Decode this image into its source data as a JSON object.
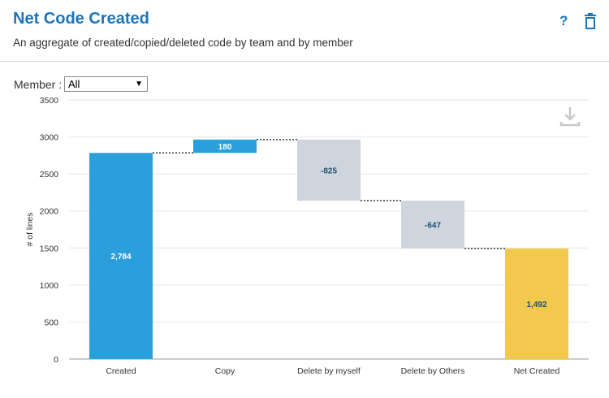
{
  "header": {
    "title": "Net Code Created",
    "subtitle": "An aggregate of created/copied/deleted code by team and by member",
    "help_label": "?"
  },
  "filter": {
    "member_label": "Member :",
    "member_value": "All"
  },
  "icons": {
    "help": "help-icon",
    "trash": "trash-icon",
    "download": "download-icon",
    "dropdown": "chevron-down-icon"
  },
  "chart_data": {
    "type": "bar",
    "subtype": "waterfall",
    "ylabel": "# of lines",
    "ylim": [
      0,
      3500
    ],
    "yticks": [
      0,
      500,
      1000,
      1500,
      2000,
      2500,
      3000,
      3500
    ],
    "grid": true,
    "categories": [
      "Created",
      "Copy",
      "Delete by myself",
      "Delete by Others",
      "Net Created"
    ],
    "values": [
      2784,
      180,
      -825,
      -647,
      1492
    ],
    "labels": [
      "2,784",
      "180",
      "-825",
      "-647",
      "1,492"
    ],
    "kinds": [
      "total",
      "delta",
      "delta",
      "delta",
      "total"
    ],
    "colors": {
      "created": "#2b9fdc",
      "increase": "#2b9fdc",
      "decrease": "#cfd5de",
      "net": "#f2c94c",
      "connector": "#333333",
      "grid": "#e6e6e6",
      "axis": "#999999"
    }
  }
}
